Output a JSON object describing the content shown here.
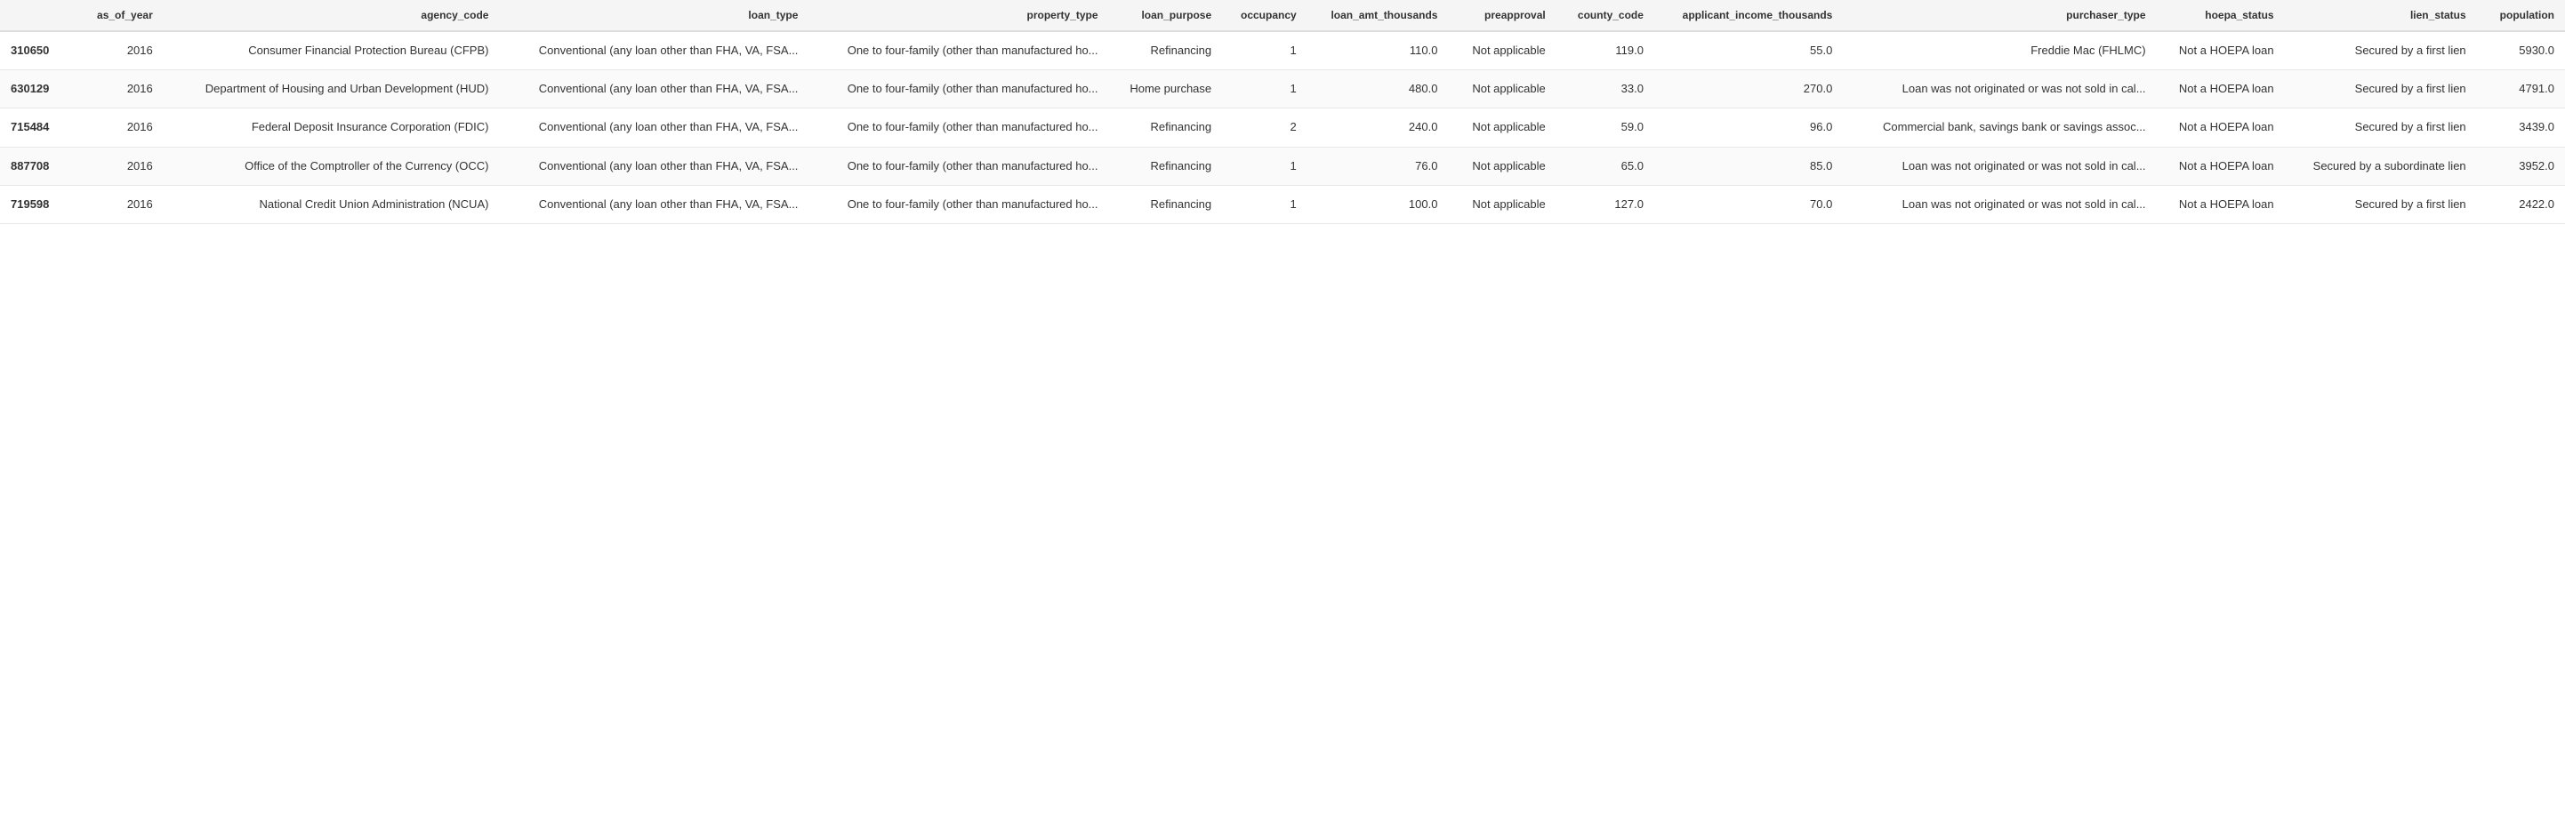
{
  "table": {
    "columns": [
      {
        "key": "id",
        "label": "",
        "class": "col-id"
      },
      {
        "key": "as_of_year",
        "label": "as_of_year",
        "class": "col-year"
      },
      {
        "key": "agency_code",
        "label": "agency_code",
        "class": "col-agency"
      },
      {
        "key": "loan_type",
        "label": "loan_type",
        "class": "col-loan-type"
      },
      {
        "key": "property_type",
        "label": "property_type",
        "class": "col-property"
      },
      {
        "key": "loan_purpose",
        "label": "loan_purpose",
        "class": "col-purpose"
      },
      {
        "key": "occupancy",
        "label": "occupancy",
        "class": "col-occupancy"
      },
      {
        "key": "loan_amt_thousands",
        "label": "loan_amt_thousands",
        "class": "col-amount"
      },
      {
        "key": "preapproval",
        "label": "preapproval",
        "class": "col-preapproval"
      },
      {
        "key": "county_code",
        "label": "county_code",
        "class": "col-county"
      },
      {
        "key": "applicant_income_thousands",
        "label": "applicant_income_thousands",
        "class": "col-income"
      },
      {
        "key": "purchaser_type",
        "label": "purchaser_type",
        "class": "col-purchaser"
      },
      {
        "key": "hoepa_status",
        "label": "hoepa_status",
        "class": "col-hoepa"
      },
      {
        "key": "lien_status",
        "label": "lien_status",
        "class": "col-lien"
      },
      {
        "key": "population",
        "label": "population",
        "class": "col-population"
      }
    ],
    "rows": [
      {
        "id": "310650",
        "as_of_year": "2016",
        "agency_code": "Consumer Financial Protection Bureau (CFPB)",
        "loan_type": "Conventional (any loan other than FHA, VA, FSA...",
        "property_type": "One to four-family (other than manufactured ho...",
        "loan_purpose": "Refinancing",
        "occupancy": "1",
        "loan_amt_thousands": "110.0",
        "preapproval": "Not applicable",
        "county_code": "119.0",
        "applicant_income_thousands": "55.0",
        "purchaser_type": "Freddie Mac (FHLMC)",
        "hoepa_status": "Not a HOEPA loan",
        "lien_status": "Secured by a first lien",
        "population": "5930.0"
      },
      {
        "id": "630129",
        "as_of_year": "2016",
        "agency_code": "Department of Housing and Urban Development (HUD)",
        "loan_type": "Conventional (any loan other than FHA, VA, FSA...",
        "property_type": "One to four-family (other than manufactured ho...",
        "loan_purpose": "Home purchase",
        "occupancy": "1",
        "loan_amt_thousands": "480.0",
        "preapproval": "Not applicable",
        "county_code": "33.0",
        "applicant_income_thousands": "270.0",
        "purchaser_type": "Loan was not originated or was not sold in cal...",
        "hoepa_status": "Not a HOEPA loan",
        "lien_status": "Secured by a first lien",
        "population": "4791.0"
      },
      {
        "id": "715484",
        "as_of_year": "2016",
        "agency_code": "Federal Deposit Insurance Corporation (FDIC)",
        "loan_type": "Conventional (any loan other than FHA, VA, FSA...",
        "property_type": "One to four-family (other than manufactured ho...",
        "loan_purpose": "Refinancing",
        "occupancy": "2",
        "loan_amt_thousands": "240.0",
        "preapproval": "Not applicable",
        "county_code": "59.0",
        "applicant_income_thousands": "96.0",
        "purchaser_type": "Commercial bank, savings bank or savings assoc...",
        "hoepa_status": "Not a HOEPA loan",
        "lien_status": "Secured by a first lien",
        "population": "3439.0"
      },
      {
        "id": "887708",
        "as_of_year": "2016",
        "agency_code": "Office of the Comptroller of the Currency (OCC)",
        "loan_type": "Conventional (any loan other than FHA, VA, FSA...",
        "property_type": "One to four-family (other than manufactured ho...",
        "loan_purpose": "Refinancing",
        "occupancy": "1",
        "loan_amt_thousands": "76.0",
        "preapproval": "Not applicable",
        "county_code": "65.0",
        "applicant_income_thousands": "85.0",
        "purchaser_type": "Loan was not originated or was not sold in cal...",
        "hoepa_status": "Not a HOEPA loan",
        "lien_status": "Secured by a subordinate lien",
        "population": "3952.0"
      },
      {
        "id": "719598",
        "as_of_year": "2016",
        "agency_code": "National Credit Union Administration (NCUA)",
        "loan_type": "Conventional (any loan other than FHA, VA, FSA...",
        "property_type": "One to four-family (other than manufactured ho...",
        "loan_purpose": "Refinancing",
        "occupancy": "1",
        "loan_amt_thousands": "100.0",
        "preapproval": "Not applicable",
        "county_code": "127.0",
        "applicant_income_thousands": "70.0",
        "purchaser_type": "Loan was not originated or was not sold in cal...",
        "hoepa_status": "Not a HOEPA loan",
        "lien_status": "Secured by a first lien",
        "population": "2422.0"
      }
    ]
  }
}
